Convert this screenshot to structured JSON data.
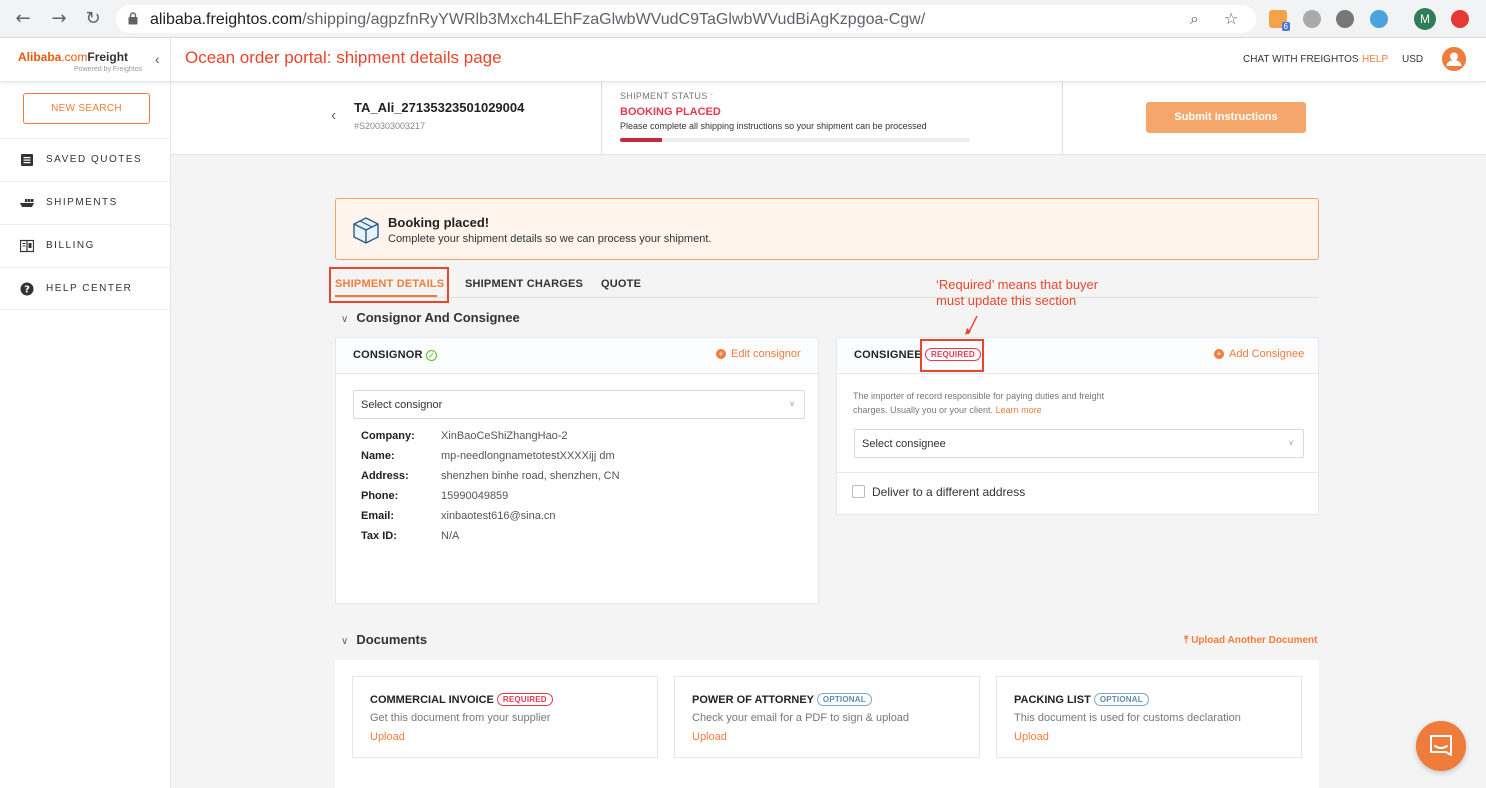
{
  "browser": {
    "url_host": "alibaba.freightos.com",
    "url_path": "/shipping/agpzfnRyYWRlb3Mxch4LEhFzaGlwbWVudC9TaGlwbWVudBiAgKzpgoa-Cgw/",
    "extension_badge": "6",
    "profile_initial": "M"
  },
  "header": {
    "logo_brand": "Alibaba",
    "logo_com": ".com",
    "logo_product": "Freight",
    "logo_sub": "Powered by Freightos",
    "caption": "Ocean order portal: shipment details page",
    "chat_link": "CHAT WITH FREIGHTOS",
    "help_link": "HELP",
    "currency": "USD"
  },
  "sidebar": {
    "new_search": "NEW SEARCH",
    "items": [
      {
        "label": "SAVED QUOTES",
        "icon": "list-icon"
      },
      {
        "label": "SHIPMENTS",
        "icon": "ship-icon"
      },
      {
        "label": "BILLING",
        "icon": "billing-icon"
      },
      {
        "label": "HELP CENTER",
        "icon": "help-icon"
      }
    ]
  },
  "shipment": {
    "id": "TA_Ali_27135323501029004",
    "ref": "#S200303003217",
    "status_label": "SHIPMENT STATUS",
    "status_value": "BOOKING PLACED",
    "status_desc": "Please complete all shipping instructions so your shipment can be processed",
    "progress": 0.12,
    "submit_btn": "Submit Instructions"
  },
  "banner": {
    "title": "Booking placed!",
    "text": "Complete your shipment details so we can process your shipment."
  },
  "tabs": [
    "SHIPMENT DETAILS",
    "SHIPMENT CHARGES",
    "QUOTE"
  ],
  "annotation": {
    "line1": "‘Required’ means that buyer",
    "line2": "must update this section"
  },
  "consignor_section": {
    "title": "Consignor And Consignee",
    "consignor": {
      "title": "CONSIGNOR",
      "action": "Edit consignor",
      "select_value": "Select consignor",
      "fields": [
        {
          "key": "Company:",
          "value": "XinBaoCeShiZhangHao-2"
        },
        {
          "key": "Name:",
          "value": "mp-needlongnametotestXXXXijj dm"
        },
        {
          "key": "Address:",
          "value": "shenzhen binhe road, shenzhen, CN"
        },
        {
          "key": "Phone:",
          "value": "15990049859"
        },
        {
          "key": "Email:",
          "value": "xinbaotest616@sina.cn"
        },
        {
          "key": "Tax ID:",
          "value": "N/A"
        }
      ]
    },
    "consignee": {
      "title": "CONSIGNEE",
      "required": "REQUIRED",
      "action": "Add Consignee",
      "desc_line1": "The importer of record responsible for paying duties and freight",
      "desc_line2": "charges. Usually you or your client.",
      "learn_more": "Learn more",
      "select_value": "Select consignee",
      "checkbox_label": "Deliver to a different address"
    }
  },
  "documents": {
    "title": "Documents",
    "upload_another": "Upload Another Document",
    "cards": [
      {
        "title": "COMMERCIAL INVOICE",
        "badge": "REQUIRED",
        "desc": "Get this document from your supplier",
        "link": "Upload"
      },
      {
        "title": "POWER OF ATTORNEY",
        "badge": "OPTIONAL",
        "desc": "Check your email for a PDF to sign & upload",
        "link": "Upload"
      },
      {
        "title": "PACKING LIST",
        "badge": "OPTIONAL",
        "desc": "This document is used for customs declaration",
        "link": "Upload"
      }
    ]
  },
  "colors": {
    "accent": "#f07c3b",
    "required": "#e53950",
    "annotation": "#e8462b"
  }
}
